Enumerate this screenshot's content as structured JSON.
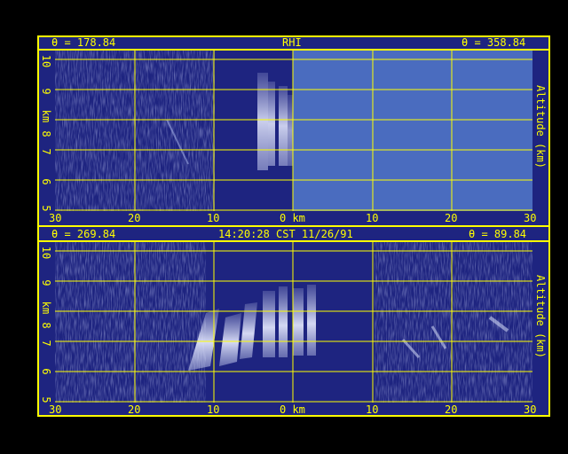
{
  "top_panel": {
    "left_angle": "θ = 178.84",
    "center_label": "RHI",
    "right_angle": "θ = 358.84",
    "y_ticks": [
      "10",
      "9",
      "8",
      "7",
      "6",
      "5"
    ],
    "y_unit": "km",
    "right_axis_title": "Altitude (km)",
    "x_ticks": [
      "30",
      "20",
      "10",
      "0 km",
      "10",
      "20",
      "30"
    ]
  },
  "bottom_panel": {
    "left_angle": "θ = 269.84",
    "center_label": "14:20:28 CST 11/26/91",
    "right_angle": "θ = 89.84",
    "y_ticks": [
      "10",
      "9",
      "8",
      "7",
      "6",
      "5"
    ],
    "y_unit": "km",
    "right_axis_title": "Altitude (km)",
    "x_ticks": [
      "30",
      "20",
      "10",
      "0 km",
      "10",
      "20",
      "30"
    ]
  },
  "colors": {
    "frame": "#ffff00",
    "background": "#1e2480",
    "no_data": "#4a6cbf",
    "echo": "#d6dcf4"
  }
}
